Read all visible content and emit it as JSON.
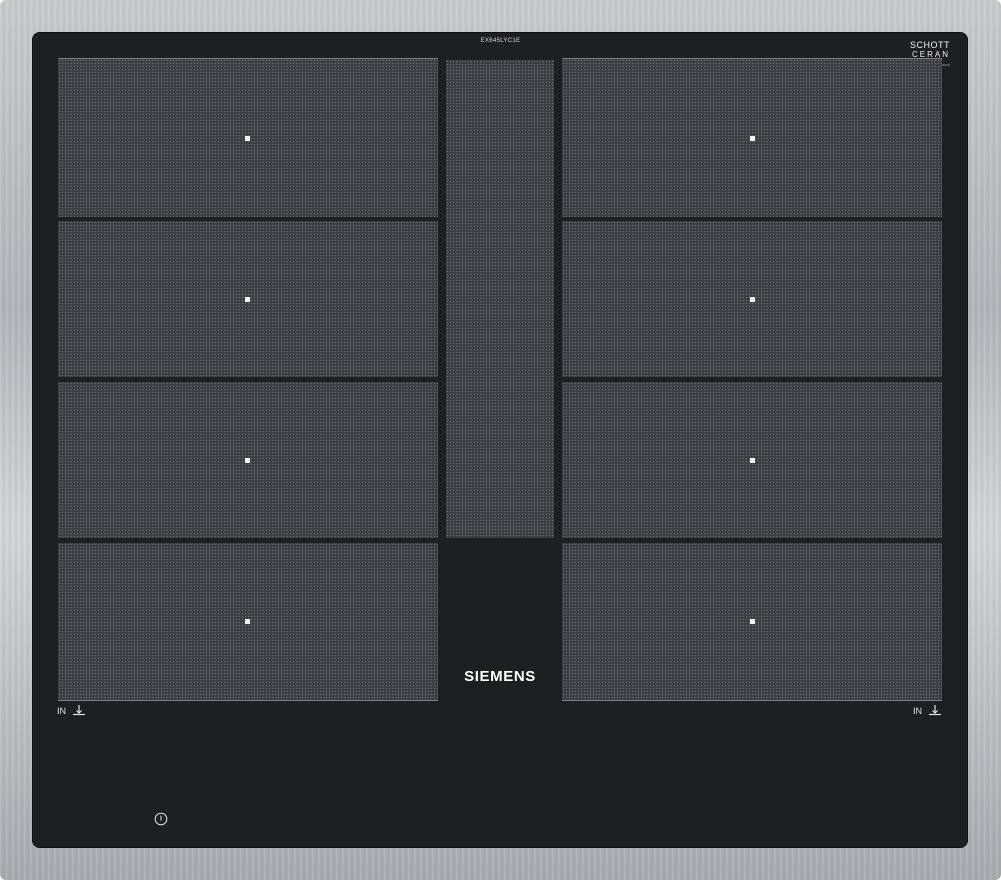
{
  "model": "EX645LYC1E",
  "schott": {
    "line1": "SCHOTT",
    "line2": "CERAN",
    "line3": "0000000000"
  },
  "brand": "SIEMENS",
  "indicators": {
    "left_label": "IN",
    "right_label": "IN"
  },
  "icons": {
    "power": "power-icon",
    "in": "heat-up-arrow-icon"
  },
  "colors": {
    "glass": "#1e1f21",
    "zone": "#3b3d40",
    "frame": "#b9bbbd",
    "text": "#ffffff"
  }
}
